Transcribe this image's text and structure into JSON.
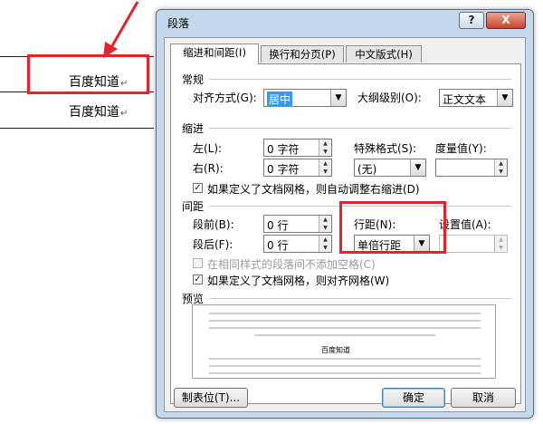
{
  "document": {
    "line1": "百度知道",
    "line2": "百度知道",
    "paragraph_mark": "↵"
  },
  "dialog": {
    "title": "段落",
    "help_label": "?",
    "close_label": "X",
    "tabs": [
      {
        "label": "缩进和间距(I)"
      },
      {
        "label": "换行和分页(P)"
      },
      {
        "label": "中文版式(H)"
      }
    ],
    "general": {
      "section_label": "常规",
      "alignment_label": "对齐方式(G):",
      "alignment_value": "居中",
      "outline_label": "大纲级别(O):",
      "outline_value": "正文文本"
    },
    "indent": {
      "section_label": "缩进",
      "left_label": "左(L):",
      "left_value": "0 字符",
      "right_label": "右(R):",
      "right_value": "0 字符",
      "special_label": "特殊格式(S):",
      "special_value": "(无)",
      "by_label": "度量值(Y):",
      "by_value": "",
      "auto_adjust_label": "如果定义了文档网格，则自动调整右缩进(D)",
      "auto_adjust_checked": true
    },
    "spacing": {
      "section_label": "间距",
      "before_label": "段前(B):",
      "before_value": "0 行",
      "after_label": "段后(F):",
      "after_value": "0 行",
      "line_spacing_label": "行距(N):",
      "line_spacing_value": "单倍行距",
      "at_label": "设置值(A):",
      "at_value": "",
      "no_space_label": "在相同样式的段落间不添加空格(C)",
      "no_space_checked": false,
      "snap_grid_label": "如果定义了文档网格，则对齐网格(W)",
      "snap_grid_checked": true
    },
    "preview": {
      "section_label": "预览",
      "sample_text": "百度知道"
    },
    "buttons": {
      "tabs_label": "制表位(T)...",
      "ok_label": "确定",
      "cancel_label": "取消"
    }
  },
  "colors": {
    "highlight_box": "#e3242b",
    "selection": "#3399ff",
    "dialog_frame": "#c5d7ea"
  }
}
